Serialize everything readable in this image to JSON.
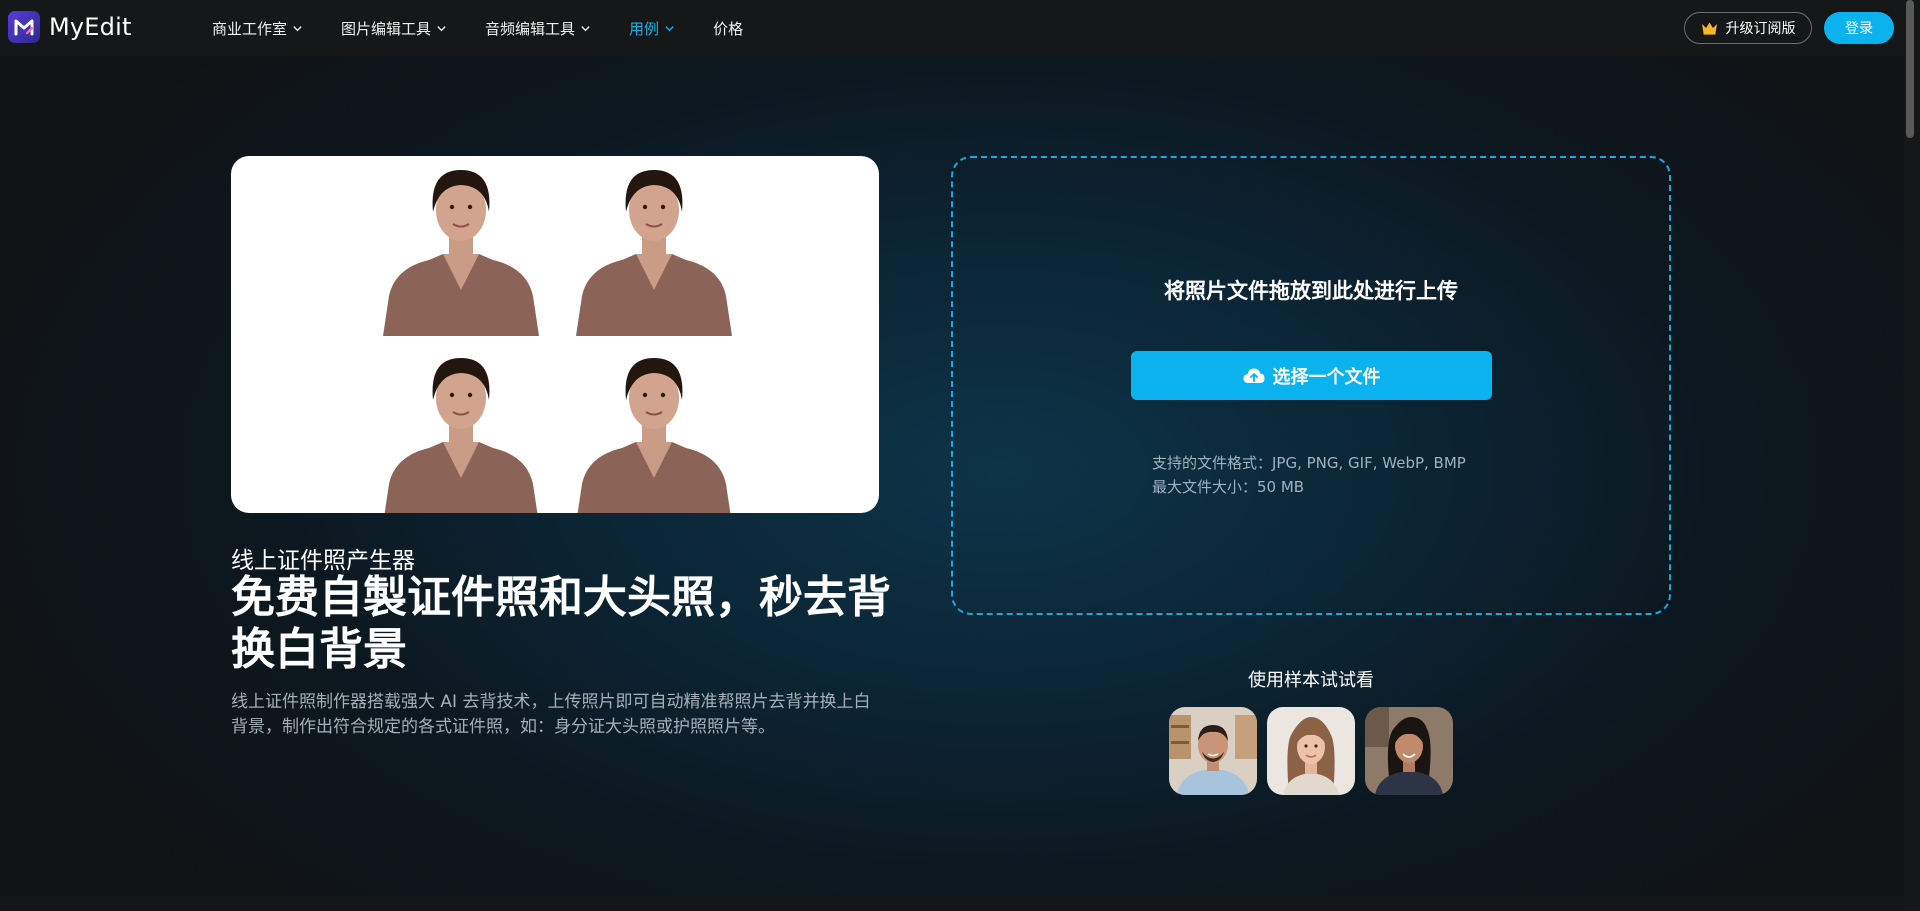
{
  "header": {
    "logo_text": "MyEdit",
    "nav": [
      {
        "label": "商业工作室",
        "has_dropdown": true,
        "active": false
      },
      {
        "label": "图片编辑工具",
        "has_dropdown": true,
        "active": false
      },
      {
        "label": "音频编辑工具",
        "has_dropdown": true,
        "active": false
      },
      {
        "label": "用例",
        "has_dropdown": true,
        "active": true
      },
      {
        "label": "价格",
        "has_dropdown": false,
        "active": false
      }
    ],
    "upgrade_label": "升级订阅版",
    "login_label": "登录"
  },
  "hero": {
    "subtitle": "线上证件照产生器",
    "headline": "免费自製证件照和大头照，秒去背换白背景",
    "description": "线上证件照制作器搭载强大 AI 去背技术，上传照片即可自动精准帮照片去背并换上白背景，制作出符合规定的各式证件照，如：身分证大头照或护照照片等。"
  },
  "upload": {
    "drop_title": "将照片文件拖放到此处进行上传",
    "choose_button": "选择一个文件",
    "supported_formats": "支持的文件格式：JPG, PNG, GIF, WebP, BMP",
    "max_size": "最大文件大小：50 MB"
  },
  "samples": {
    "title": "使用样本试试看",
    "items": [
      "sample-man",
      "sample-girl",
      "sample-woman"
    ]
  },
  "colors": {
    "accent": "#0bb3ee",
    "active_nav": "#16b3e9",
    "header_bg": "#161718",
    "dropzone_border": "#1aa7e2"
  },
  "icons": [
    "chevron-down-icon",
    "crown-icon",
    "cloud-upload-icon"
  ]
}
